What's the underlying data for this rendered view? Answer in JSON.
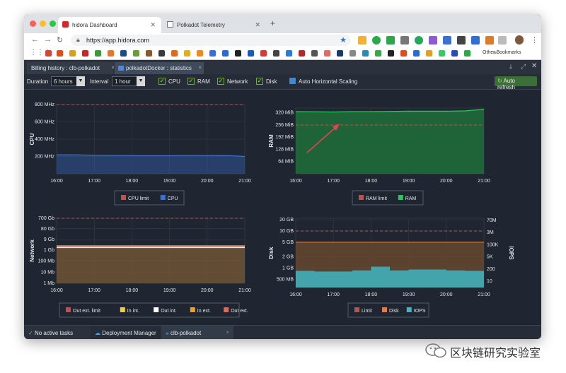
{
  "browser": {
    "tabs": [
      {
        "title": "hidora Dashboard"
      },
      {
        "title": "Polkadot Telemetry"
      }
    ],
    "url": "https://app.hidora.com",
    "other_bookmarks": "Other Bookmarks",
    "bookmark_overflow": "»"
  },
  "app_tabs": [
    {
      "label": "Billing history : clb-polkadot",
      "close": "×"
    },
    {
      "label": "polkadotDocker : statistics",
      "close": "×"
    }
  ],
  "toolbar": {
    "duration_label": "Duration",
    "duration_value": "6 hours",
    "interval_label": "Interval",
    "interval_value": "1 hour",
    "checks": [
      {
        "label": "CPU"
      },
      {
        "label": "RAM"
      },
      {
        "label": "Network"
      },
      {
        "label": "Disk"
      }
    ],
    "scaling_label": "Auto Horizontal Scaling",
    "refresh_label": "Auto refresh"
  },
  "status": {
    "tasks": "No active tasks",
    "deployment_manager": "Deployment Manager",
    "env": "clb-polkadot",
    "close": "×"
  },
  "watermark": "区块链研究实验室",
  "colors": {
    "cpu": "#3a6fd8",
    "ram": "#2ec25a",
    "limit": "#c0504d",
    "out_ext": "#d86d5a",
    "in_int": "#e8d33a",
    "out_int": "#ffffff",
    "in_ext": "#f0a020",
    "disk": "#e37b4a",
    "iops": "#3fb6c1"
  },
  "chart_data": [
    {
      "type": "area",
      "title": "",
      "ylabel": "CPU",
      "x": [
        "16:00",
        "17:00",
        "18:00",
        "19:00",
        "20:00",
        "21:00"
      ],
      "yticks": [
        "800 MHz",
        "600 MHz",
        "400 MHz",
        "200 MHz"
      ],
      "ylim": [
        0,
        800
      ],
      "series": [
        {
          "name": "CPU limit",
          "values": [
            800,
            800,
            800,
            800,
            800,
            800,
            800,
            800,
            800,
            800,
            800
          ]
        },
        {
          "name": "CPU",
          "values": [
            220,
            220,
            215,
            212,
            210,
            210,
            210,
            212,
            210,
            212,
            200
          ]
        }
      ],
      "legend": "bottom"
    },
    {
      "type": "area",
      "title": "",
      "ylabel": "RAM",
      "x": [
        "16:00",
        "17:00",
        "18:00",
        "19:00",
        "20:00",
        "21:00"
      ],
      "yticks": [
        "320 MiB",
        "256 MiB",
        "192 MiB",
        "128 MiB",
        "64 MiB"
      ],
      "ylim": [
        0,
        345
      ],
      "series": [
        {
          "name": "RAM limit",
          "values": [
            256,
            256,
            256,
            256,
            256,
            256,
            256,
            256,
            256,
            256,
            256
          ]
        },
        {
          "name": "RAM",
          "values": [
            336,
            335,
            334,
            336,
            336,
            337,
            338,
            338,
            338,
            340,
            348
          ]
        }
      ],
      "legend": "bottom"
    },
    {
      "type": "area",
      "title": "",
      "ylabel": "Network",
      "x": [
        "16:00",
        "17:00",
        "18:00",
        "19:00",
        "20:00",
        "21:00"
      ],
      "yticks": [
        "700 Gb",
        "80 Gb",
        "9 Gb",
        "1 Gb",
        "100 Mb",
        "10 Mb",
        "1 Mb"
      ],
      "series": [
        {
          "name": "Out ext. limit",
          "values": [
            700,
            700,
            700,
            700,
            700,
            700,
            700,
            700,
            700,
            700,
            700
          ]
        },
        {
          "name": "In int.",
          "values": [
            1.9,
            1.9,
            1.9,
            1.9,
            1.9,
            1.9,
            1.9,
            1.9,
            1.9,
            1.9,
            1.9
          ]
        },
        {
          "name": "Out int.",
          "values": [
            1.6,
            1.6,
            1.6,
            1.6,
            1.6,
            1.6,
            1.6,
            1.6,
            1.6,
            1.6,
            1.6
          ]
        },
        {
          "name": "In ext.",
          "values": [
            2.4,
            2.4,
            2.4,
            2.4,
            2.4,
            2.4,
            2.4,
            2.4,
            2.4,
            2.4,
            2.4
          ]
        },
        {
          "name": "Out ext.",
          "values": [
            2.2,
            2.2,
            2.2,
            2.2,
            2.2,
            2.2,
            2.2,
            2.2,
            2.2,
            2.2,
            2.2
          ]
        }
      ],
      "legend": "bottom"
    },
    {
      "type": "area",
      "title": "",
      "ylabel": "Disk",
      "y2label": "IOPS",
      "x": [
        "16:00",
        "17:00",
        "18:00",
        "19:00",
        "20:00",
        "21:00"
      ],
      "yticks": [
        "20 GB",
        "10 GB",
        "5 GB",
        "2 GB",
        "1 GB",
        "500 MB"
      ],
      "y2ticks": [
        "70M",
        "3M",
        "100K",
        "5K",
        "200",
        "10"
      ],
      "series": [
        {
          "name": "Limit",
          "values": [
            10,
            10,
            10,
            10,
            10,
            10,
            10,
            10,
            10,
            10,
            10
          ]
        },
        {
          "name": "Disk",
          "values": [
            5,
            5,
            5,
            5,
            5,
            5,
            5,
            5,
            5,
            5,
            5
          ]
        },
        {
          "name": "IOPS",
          "values": [
            180,
            150,
            150,
            200,
            500,
            200,
            250,
            250,
            200,
            180,
            150
          ]
        }
      ],
      "legend": "bottom"
    }
  ]
}
